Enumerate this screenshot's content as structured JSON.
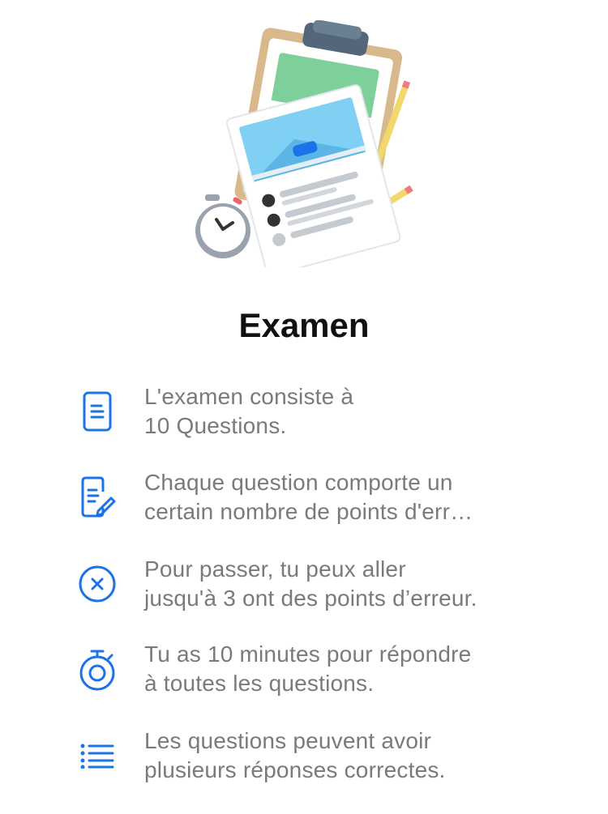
{
  "hero": {
    "illustration": "exam-clipboard-stopwatch-illustration"
  },
  "title": "Examen",
  "rules": [
    {
      "icon": "document-icon",
      "lines": [
        "L'examen consiste à",
        "10 Questions."
      ]
    },
    {
      "icon": "document-edit-icon",
      "lines": [
        "Chaque question comporte un",
        "certain nombre de points d'err…"
      ]
    },
    {
      "icon": "close-circle-icon",
      "lines": [
        "Pour passer, tu peux aller",
        "jusqu'à 3 ont des points d’erreur."
      ]
    },
    {
      "icon": "stopwatch-icon",
      "lines": [
        "Tu as 10 minutes pour répondre",
        "à toutes les questions."
      ]
    },
    {
      "icon": "list-icon",
      "lines": [
        "Les questions peuvent avoir",
        "plusieurs réponses correctes."
      ]
    }
  ],
  "colors": {
    "accent": "#1a73e8",
    "text": "#7a7a7a",
    "title": "#111111"
  }
}
